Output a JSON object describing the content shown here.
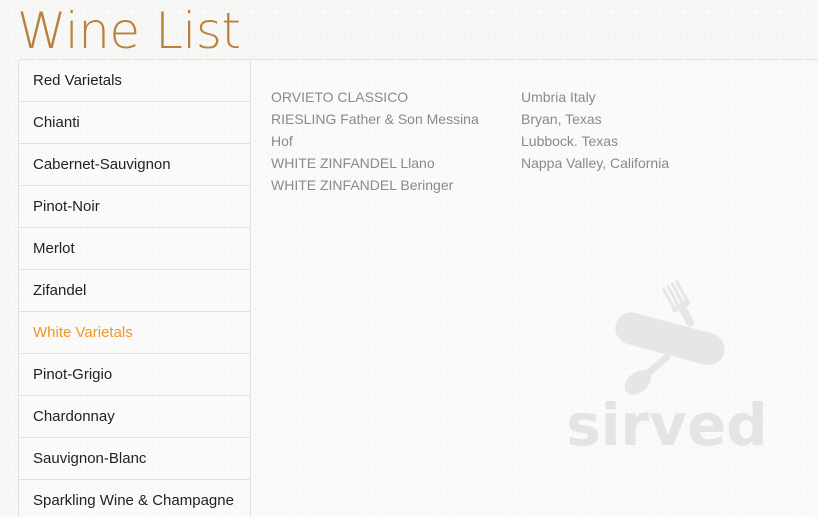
{
  "page": {
    "title": "Wine List"
  },
  "sidebar": {
    "items": [
      {
        "label": "Red Varietals",
        "active": false
      },
      {
        "label": "Chianti",
        "active": false
      },
      {
        "label": "Cabernet-Sauvignon",
        "active": false
      },
      {
        "label": "Pinot-Noir",
        "active": false
      },
      {
        "label": "Merlot",
        "active": false
      },
      {
        "label": "Zifandel",
        "active": false
      },
      {
        "label": "White Varietals",
        "active": true
      },
      {
        "label": "Pinot-Grigio",
        "active": false
      },
      {
        "label": "Chardonnay",
        "active": false
      },
      {
        "label": "Sauvignon-Blanc",
        "active": false
      },
      {
        "label": "Sparkling Wine & Champagne",
        "active": false
      }
    ]
  },
  "wines": {
    "names": [
      "ORVIETO CLASSICO",
      "RIESLING Father & Son Messina",
      "Hof",
      "WHITE ZINFANDEL Llano",
      "WHITE ZINFANDEL Beringer"
    ],
    "origins": [
      "Umbria Italy",
      "Bryan, Texas",
      "Lubbock. Texas",
      "Nappa Valley, California"
    ]
  },
  "watermark": {
    "text": "sirved",
    "icon": "multitool-utensils-icon"
  },
  "colors": {
    "title": "#b8823d",
    "active_item": "#f0962a",
    "menu_text": "#222222",
    "wine_text": "#8a8a8a",
    "border": "#e1e1e1"
  }
}
